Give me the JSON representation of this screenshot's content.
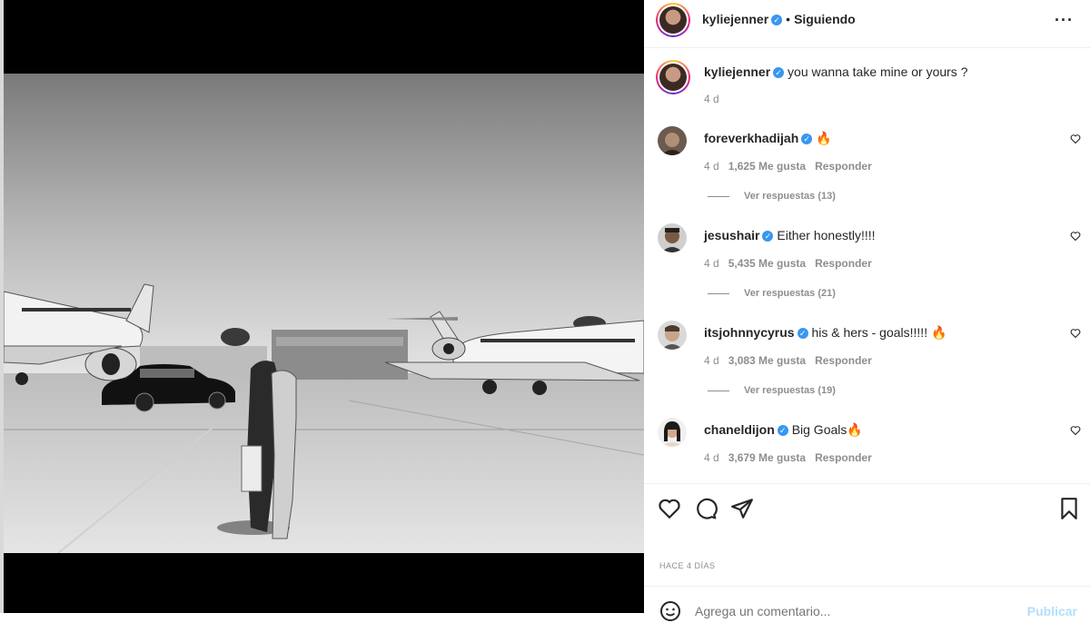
{
  "post": {
    "header": {
      "username": "kyliejenner",
      "separator": "•",
      "follow_status": "Siguiendo",
      "more_icon": "ellipsis-icon"
    },
    "caption": {
      "username": "kyliejenner",
      "text": "you wanna take mine or yours ?",
      "time": "4 d"
    },
    "comments": [
      {
        "username": "foreverkhadijah",
        "text": "🔥",
        "time": "4 d",
        "likes": "1,625 Me gusta",
        "reply": "Responder",
        "replies": "Ver respuestas (13)"
      },
      {
        "username": "jesushair",
        "text": "Either honestly!!!!",
        "time": "4 d",
        "likes": "5,435 Me gusta",
        "reply": "Responder",
        "replies": "Ver respuestas (21)"
      },
      {
        "username": "itsjohnnycyrus",
        "text": "his & hers - goals!!!!! 🔥",
        "time": "4 d",
        "likes": "3,083 Me gusta",
        "reply": "Responder",
        "replies": "Ver respuestas (19)"
      },
      {
        "username": "chaneldijon",
        "text": "Big Goals🔥",
        "time": "4 d",
        "likes": "3,679 Me gusta",
        "reply": "Responder",
        "replies": ""
      }
    ],
    "timestamp": "HACE 4 DÍAS",
    "add_comment": {
      "placeholder": "Agrega un comentario...",
      "post_label": "Publicar"
    },
    "colors": {
      "verified": "#3897f0",
      "publish_disabled": "#b2dffc"
    }
  }
}
